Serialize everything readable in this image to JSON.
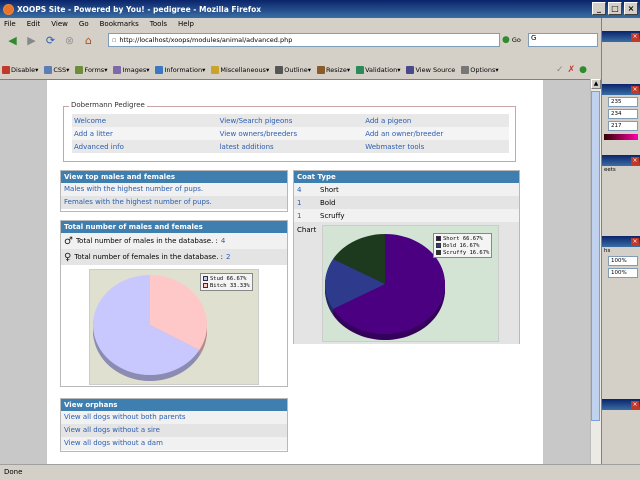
{
  "window": {
    "title": "XOOPS Site - Powered by You! - pedigree - Mozilla Firefox",
    "buttons": [
      "_",
      "□",
      "×"
    ]
  },
  "menu": [
    "File",
    "Edit",
    "View",
    "Go",
    "Bookmarks",
    "Tools",
    "Help"
  ],
  "nav": {
    "url": "http://localhost/xoops/modules/animal/advanced.php",
    "go_label": "Go",
    "search_value": "G"
  },
  "devbar": [
    {
      "label": "Disable▾",
      "icon": "disable-icon",
      "color": "#c0392b"
    },
    {
      "label": "CSS▾",
      "icon": "css-icon",
      "color": "#5b7fb4"
    },
    {
      "label": "Forms▾",
      "icon": "forms-icon",
      "color": "#6a8e3a"
    },
    {
      "label": "Images▾",
      "icon": "images-icon",
      "color": "#7d6aa6"
    },
    {
      "label": "Information▾",
      "icon": "information-icon",
      "color": "#3a78c2"
    },
    {
      "label": "Miscellaneous▾",
      "icon": "miscellaneous-icon",
      "color": "#c9a32a"
    },
    {
      "label": "Outline▾",
      "icon": "outline-icon",
      "color": "#555555"
    },
    {
      "label": "Resize▾",
      "icon": "resize-icon",
      "color": "#8a5a2a"
    },
    {
      "label": "Validation▾",
      "icon": "validation-icon",
      "color": "#2a8a5a"
    },
    {
      "label": "View Source",
      "icon": "view-source-icon",
      "color": "#4a4a8a"
    },
    {
      "label": "Options▾",
      "icon": "options-icon",
      "color": "#777777"
    }
  ],
  "pedigree": {
    "legend": "Dobermann Pedigree",
    "rows": [
      [
        "Welcome",
        "View/Search pigeons",
        "Add a pigeon"
      ],
      [
        "Add a litter",
        "View owners/breeders",
        "Add an owner/breeder"
      ],
      [
        "Advanced info",
        "latest additions",
        "Webmaster tools"
      ]
    ]
  },
  "top_males_females": {
    "title": "View top males and females",
    "items": [
      "Males with the highest number of pups.",
      "Females with the highest number of pups."
    ]
  },
  "totals": {
    "title": "Total number of males and females",
    "males_label": "Total number of males in the database. :",
    "males_count": "4",
    "females_label": "Total number of females in the database. :",
    "females_count": "2",
    "male_symbol": "♂",
    "female_symbol": "♀"
  },
  "sex_chart": {
    "legend": [
      "Stud 66.67%",
      "Bitch 33.33%"
    ],
    "colors": [
      "#c8c8ff",
      "#ffc8c8"
    ],
    "values": [
      66.67,
      33.33
    ]
  },
  "orphans": {
    "title": "View orphans",
    "items": [
      "View all dogs without both parents",
      "View all dogs without a sire",
      "View all dogs without a dam"
    ]
  },
  "coat": {
    "title": "Coat Type",
    "rows": [
      {
        "count": "4",
        "type": "Short"
      },
      {
        "count": "1",
        "type": "Bold"
      },
      {
        "count": "1",
        "type": "Scruffy"
      }
    ],
    "chart_label": "Chart"
  },
  "coat_chart": {
    "legend": [
      "Short 66.67%",
      "Bold 16.67%",
      "Scruffy 16.67%"
    ],
    "colors": [
      "#4b0082",
      "#2e3a8c",
      "#1e3a1e"
    ],
    "values": [
      66.67,
      16.67,
      16.67
    ]
  },
  "side": {
    "values": [
      "235",
      "234",
      "217"
    ],
    "zoom": [
      "100%",
      "100%"
    ],
    "labels": [
      "eets",
      "hs"
    ]
  },
  "status": "Done"
}
